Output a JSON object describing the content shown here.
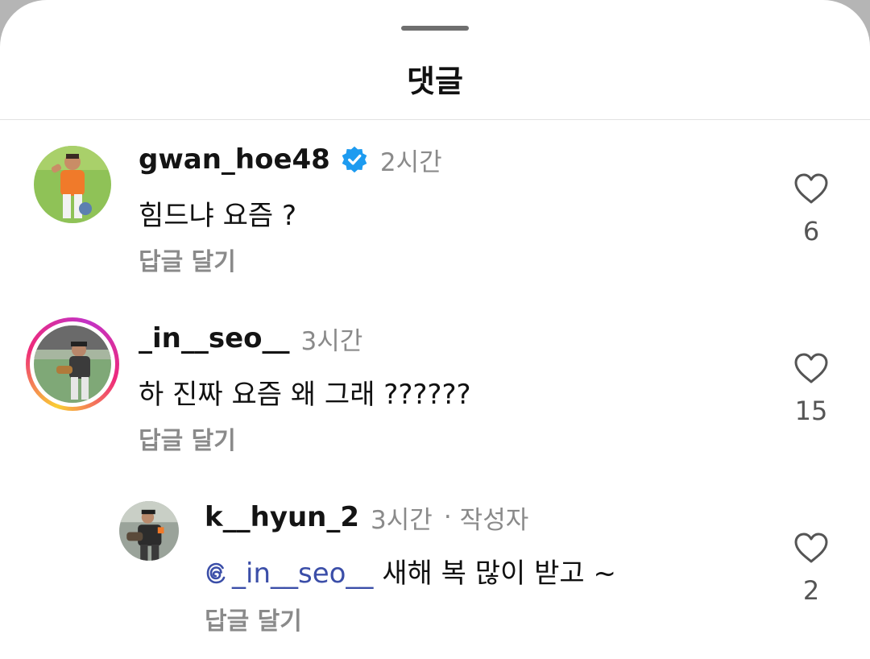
{
  "sheet": {
    "title": "댓글"
  },
  "comments": [
    {
      "username": "gwan_hoe48",
      "verified": true,
      "time": "2시간",
      "text": "힘드냐 요즘 ?",
      "reply_label": "답글 달기",
      "likes": "6"
    },
    {
      "username": "_in__seo__",
      "story_ring": true,
      "time": "3시간",
      "text": "하 진짜 요즘 왜 그래 ??????",
      "reply_label": "답글 달기",
      "likes": "15"
    },
    {
      "username": "k__hyun_2",
      "time": "3시간",
      "separator": "·",
      "author_tag": "작성자",
      "mention": "_in__seo__",
      "text": "새해 복 많이 받고 ~",
      "reply_label": "답글 달기",
      "likes": "2"
    }
  ],
  "colors": {
    "verified_badge": "#1d9bf0",
    "mention": "#3b4ea8",
    "secondary_text": "#8a8a8a"
  }
}
